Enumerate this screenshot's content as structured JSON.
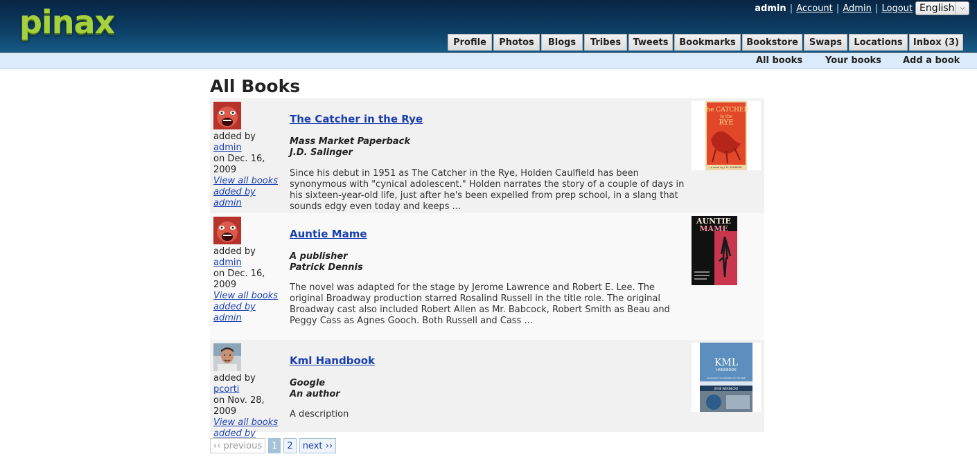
{
  "header": {
    "logo": "pinax",
    "username": "admin",
    "links": [
      "Account",
      "Admin",
      "Logout"
    ],
    "language": "English"
  },
  "tabs": [
    "Profile",
    "Photos",
    "Blogs",
    "Tribes",
    "Tweets",
    "Bookmarks",
    "Bookstore",
    "Swaps",
    "Locations",
    "Inbox (3)"
  ],
  "subnav": [
    "All books",
    "Your books",
    "Add a book"
  ],
  "page_title": "All Books",
  "books": [
    {
      "title": "The Catcher in the Rye",
      "publisher": "Mass Market Paperback",
      "author": "J.D. Salinger",
      "added_by_prefix": "added by",
      "user": "admin",
      "date": "on Dec. 16, 2009",
      "view_all_line1": "View all books",
      "view_all_line2": "added by admin",
      "description": "Since his debut in 1951 as The Catcher in the Rye, Holden Caulfield has been synonymous with \"cynical adolescent.\" Holden narrates the story of a couple of days in his sixteen-year-old life, just after he's been expelled from prep school, in a slang that sounds edgy even today and keeps ...",
      "cover_text": [
        "the CATCHER",
        "in the",
        "RYE",
        "a novel by J. D. SALINGER"
      ],
      "cover_color": "#e2472a"
    },
    {
      "title": "Auntie Mame",
      "publisher": "A publisher",
      "author": "Patrick Dennis",
      "added_by_prefix": "added by",
      "user": "admin",
      "date": "on Dec. 16, 2009",
      "view_all_line1": "View all books",
      "view_all_line2": "added by admin",
      "description": "The novel was adapted for the stage by Jerome Lawrence and Robert E. Lee. The original Broadway production starred Rosalind Russell in the title role. The original Broadway cast also included Robert Allen as Mr. Babcock, Robert Smith as Beau and Peggy Cass as Agnes Gooch. Both Russell and Cass ...",
      "cover_text": [
        "AUNTIE",
        "MAME"
      ],
      "cover_color": "#c8364f"
    },
    {
      "title": "Kml Handbook",
      "publisher": "Google",
      "author": "An author",
      "added_by_prefix": "added by",
      "user": "pcorti",
      "date": "on Nov. 28, 2009",
      "view_all_line1": "View all books",
      "view_all_line2": "added by pcorti",
      "description": "A description",
      "cover_text": [
        "KML",
        "HANDBOOK",
        "Geographic Visualization for the Web",
        "JOSIE WERNECKE"
      ],
      "cover_color": "#2f5f8c"
    }
  ],
  "pagination": {
    "previous": "‹‹ previous",
    "pages": [
      "1",
      "2"
    ],
    "current": "1",
    "next": "next ››"
  }
}
